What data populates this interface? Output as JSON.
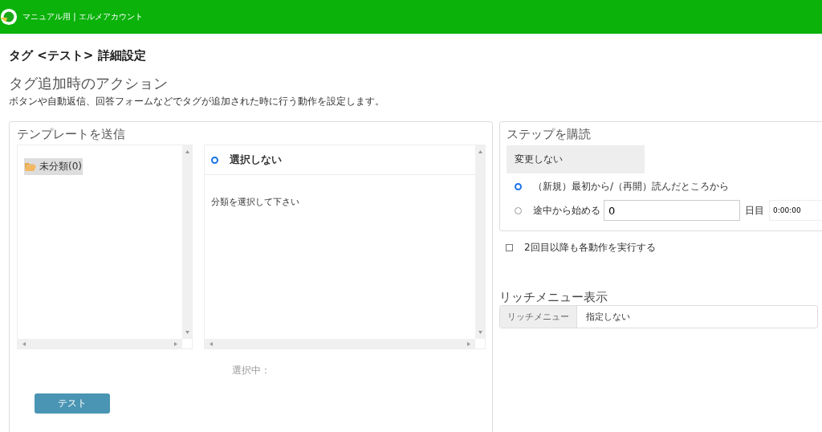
{
  "header": {
    "account": "マニュアル用 | エルメアカウント"
  },
  "page_title": "タグ <テスト> 詳細設定",
  "section": {
    "title": "タグ追加時のアクション",
    "description": "ボタンや自動返信、回答フォームなどでタグが追加された時に行う動作を設定します。"
  },
  "template": {
    "title": "テンプレートを送信",
    "folders": [
      {
        "label": "未分類(0)",
        "selected": true
      }
    ],
    "options": [
      {
        "label": "選択しない",
        "selected": true
      }
    ],
    "hint": "分類を選択して下さい",
    "selected_label": "選択中：",
    "test_button": "テスト"
  },
  "step": {
    "title": "ステップを購読",
    "current": "変更しない",
    "options": [
      {
        "kind": "plain",
        "label": "（新規）最初から/（再開）読んだところから",
        "selected": true
      },
      {
        "kind": "offset",
        "label": "途中から始める",
        "selected": false,
        "value": "0",
        "unit": "日目",
        "time": "0:00:00"
      }
    ]
  },
  "repeat": {
    "label": "2回目以降も各動作を実行する",
    "checked": false
  },
  "rich_menu": {
    "title": "リッチメニュー表示",
    "addon": "リッチメニュー",
    "value": "指定しない"
  }
}
